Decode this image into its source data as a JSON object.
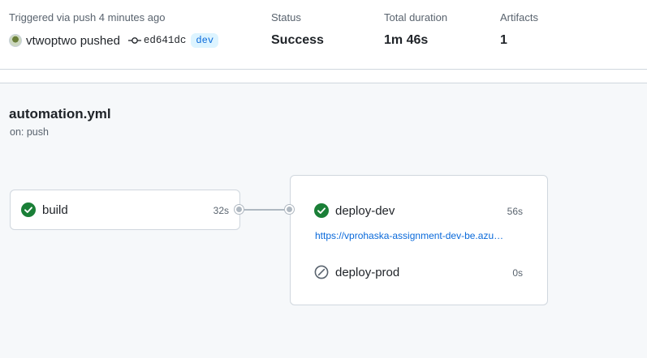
{
  "summary": {
    "trigger_text": "Triggered via push 4 minutes ago",
    "actor": "vtwoptwo pushed",
    "commit_sha": "ed641dc",
    "branch": "dev",
    "status_label": "Status",
    "status_value": "Success",
    "duration_label": "Total duration",
    "duration_value": "1m 46s",
    "artifacts_label": "Artifacts",
    "artifacts_value": "1"
  },
  "workflow": {
    "file": "automation.yml",
    "trigger": "on: push"
  },
  "jobs": {
    "build": {
      "name": "build",
      "duration": "32s",
      "status": "success"
    },
    "deploy_dev": {
      "name": "deploy-dev",
      "duration": "56s",
      "status": "success",
      "link": "https://vprohaska-assignment-dev-be.azu…"
    },
    "deploy_prod": {
      "name": "deploy-prod",
      "duration": "0s",
      "status": "skipped"
    }
  },
  "colors": {
    "success": "#1a7f37",
    "skipped": "#59636e",
    "link": "#0969da",
    "connector": "#afb8c1"
  },
  "icons": {
    "success": "check-circle-fill-icon",
    "skipped": "skip-circle-icon",
    "commit": "git-commit-icon"
  }
}
